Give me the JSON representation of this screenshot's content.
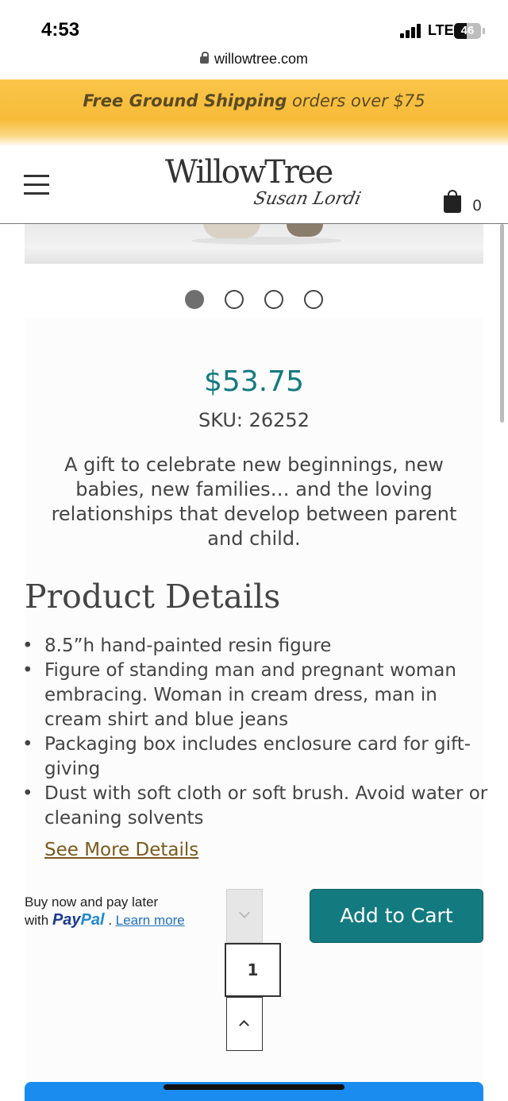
{
  "status_bar": {
    "time": "4:53",
    "network": "LTE",
    "battery": "46",
    "battery_level": 0.46,
    "url": "willowtree.com"
  },
  "banner": {
    "bold_text": "Free Ground Shipping",
    "text": " orders over $75",
    "color": "#f7bb38"
  },
  "header": {
    "logo_main": "WillowTree",
    "logo_sub": "Susan Lordi",
    "cart_count": "0"
  },
  "carousel": {
    "slide_count": 4,
    "active_index": 0
  },
  "product": {
    "price": "$53.75",
    "price_color": "#147a80",
    "sku": "SKU: 26252",
    "description": "A gift to celebrate new beginnings, new babies, new families… and the loving relationships that develop between parent and child."
  },
  "details": {
    "title": "Product Details",
    "items": [
      "8.5”h hand-painted resin figure",
      "Figure of standing man and pregnant woman embracing. Woman in cream dress, man in cream shirt and blue jeans",
      "Packaging box includes enclosure card for gift-giving",
      "Dust with soft cloth or soft brush. Avoid water or cleaning solvents"
    ],
    "see_more": "See More Details"
  },
  "paypal": {
    "line1": "Buy now and pay later",
    "with": "with ",
    "brand_pay": "Pay",
    "brand_pal": "Pal",
    "separator": " . ",
    "learn_more": "Learn more"
  },
  "purchase": {
    "quantity": "1",
    "add_to_cart": "Add to Cart",
    "button_color": "#137b80"
  }
}
